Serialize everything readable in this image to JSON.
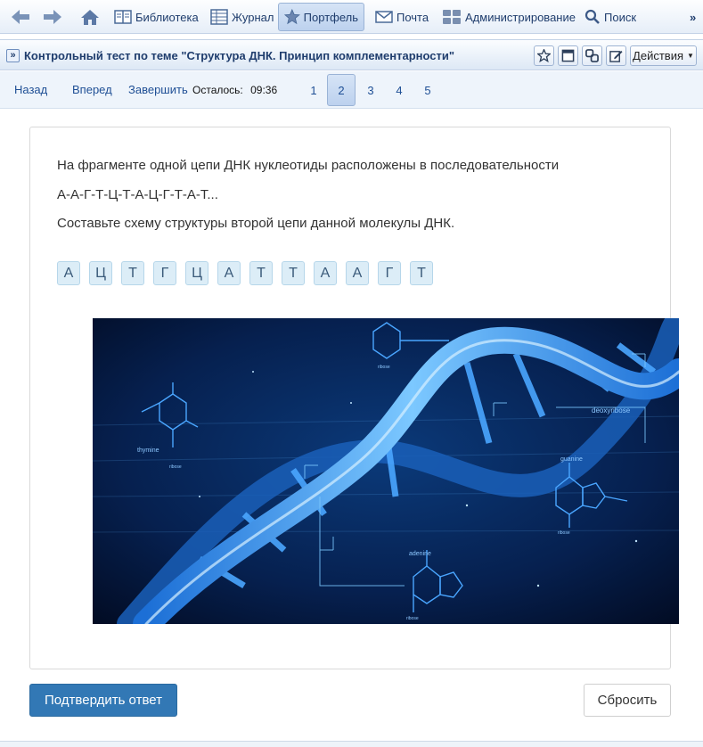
{
  "toolbar": {
    "items": [
      {
        "label": "Библиотека",
        "icon": "library-icon"
      },
      {
        "label": "Журнал",
        "icon": "journal-icon"
      },
      {
        "label": "Портфель",
        "icon": "star-icon",
        "active": true
      },
      {
        "label": "Почта",
        "icon": "mail-icon"
      },
      {
        "label": "Администрирование",
        "icon": "users-icon"
      },
      {
        "label": "Поиск",
        "icon": "search-icon"
      }
    ],
    "more": "»"
  },
  "title": {
    "chevron": "»",
    "text": "Контрольный тест по теме \"Структура ДНК. Принцип комплементарности\"",
    "actions_label": "Действия"
  },
  "nav": {
    "back": "Назад",
    "forward": "Вперед",
    "finish": "Завершить",
    "remaining_label": "Осталось:",
    "remaining_time": "09:36",
    "pages": [
      "1",
      "2",
      "3",
      "4",
      "5"
    ],
    "current_page": "2"
  },
  "question": {
    "line1": "На фрагменте одной цепи ДНК нуклеотиды расположены в последовательности",
    "line2": "А-А-Г-Т-Ц-Т-А-Ц-Г-Т-А-Т...",
    "line3": "Составьте схему структуры второй цепи данной молекулы ДНК.",
    "tiles": [
      "А",
      "Ц",
      "Т",
      "Г",
      "Ц",
      "А",
      "Т",
      "Т",
      "А",
      "А",
      "Г",
      "Т"
    ]
  },
  "image": {
    "labels": {
      "thymine": "thymine",
      "ribose1": "ribose",
      "deoxyribose": "deoxyribose",
      "guanine": "guanine",
      "ribose2": "ribose",
      "adenine": "adenine",
      "ribose3": "ribose",
      "ribose4": "ribose"
    }
  },
  "buttons": {
    "confirm": "Подтвердить ответ",
    "reset": "Сбросить"
  },
  "colors": {
    "accent": "#3278b5",
    "link": "#1f4f95",
    "tile_bg": "#dcedf7",
    "image_bg": "#03112e",
    "helix": "#3aa8ff"
  }
}
